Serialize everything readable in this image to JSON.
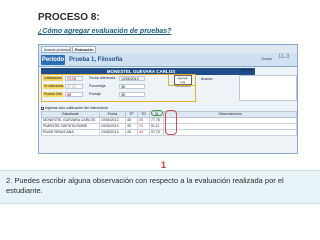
{
  "slide": {
    "title": "PROCESO 8:",
    "subtitle": "¿Cómo  agregar evaluación de pruebas?",
    "step_marker": "1",
    "caption": "2. Puedes escribir alguna observación con respecto a la evaluación realizada por el estudiante."
  },
  "app": {
    "tabs": [
      {
        "label": "Avance procesos"
      },
      {
        "label": "Evaluación"
      }
    ],
    "period": "Período 1",
    "evaluation_title": "Prueba 1, Filosofía",
    "grado_label": "Grado",
    "grado_value": "11-3",
    "student_name": "MONESTEL GUEVARA CARLOS",
    "observations_label": "Manejo",
    "fields": {
      "calificacion_label": "Calificación",
      "calificacion_value": "77,78",
      "valorados_label": "% valorados",
      "valorados_value": "27,22",
      "puntos_label": "Puntos Obt.",
      "puntos_value": "35",
      "fecha_label": "Fecha referencia",
      "fecha_value": "19/05/2013",
      "porcentaje_label": "Porcentaje",
      "porcentaje_value": "35",
      "puntaje_label": "Puntaje",
      "puntaje_value": "45",
      "avance_label": "Avance"
    },
    "add_button": "Agregar eva. instrumento",
    "comment_row": "Ingresar sólo calificación del instrumento",
    "grid": {
      "headers": [
        "Estudiante",
        "Fecha",
        "TP",
        "TO",
        "%",
        "Observaciones"
      ],
      "rows": [
        [
          "MONESTEL GUEVARA CARLOS",
          "19/05/2013",
          "45",
          "35",
          "77,78",
          ""
        ],
        [
          "PIMENTEL BATISTA ROBIS",
          "19/05/2013",
          "45",
          "23",
          "51,11",
          ""
        ],
        [
          "RIVAS SIRIAS ANA",
          "19/05/2013",
          "45",
          "44",
          "97,78",
          ""
        ]
      ]
    }
  }
}
